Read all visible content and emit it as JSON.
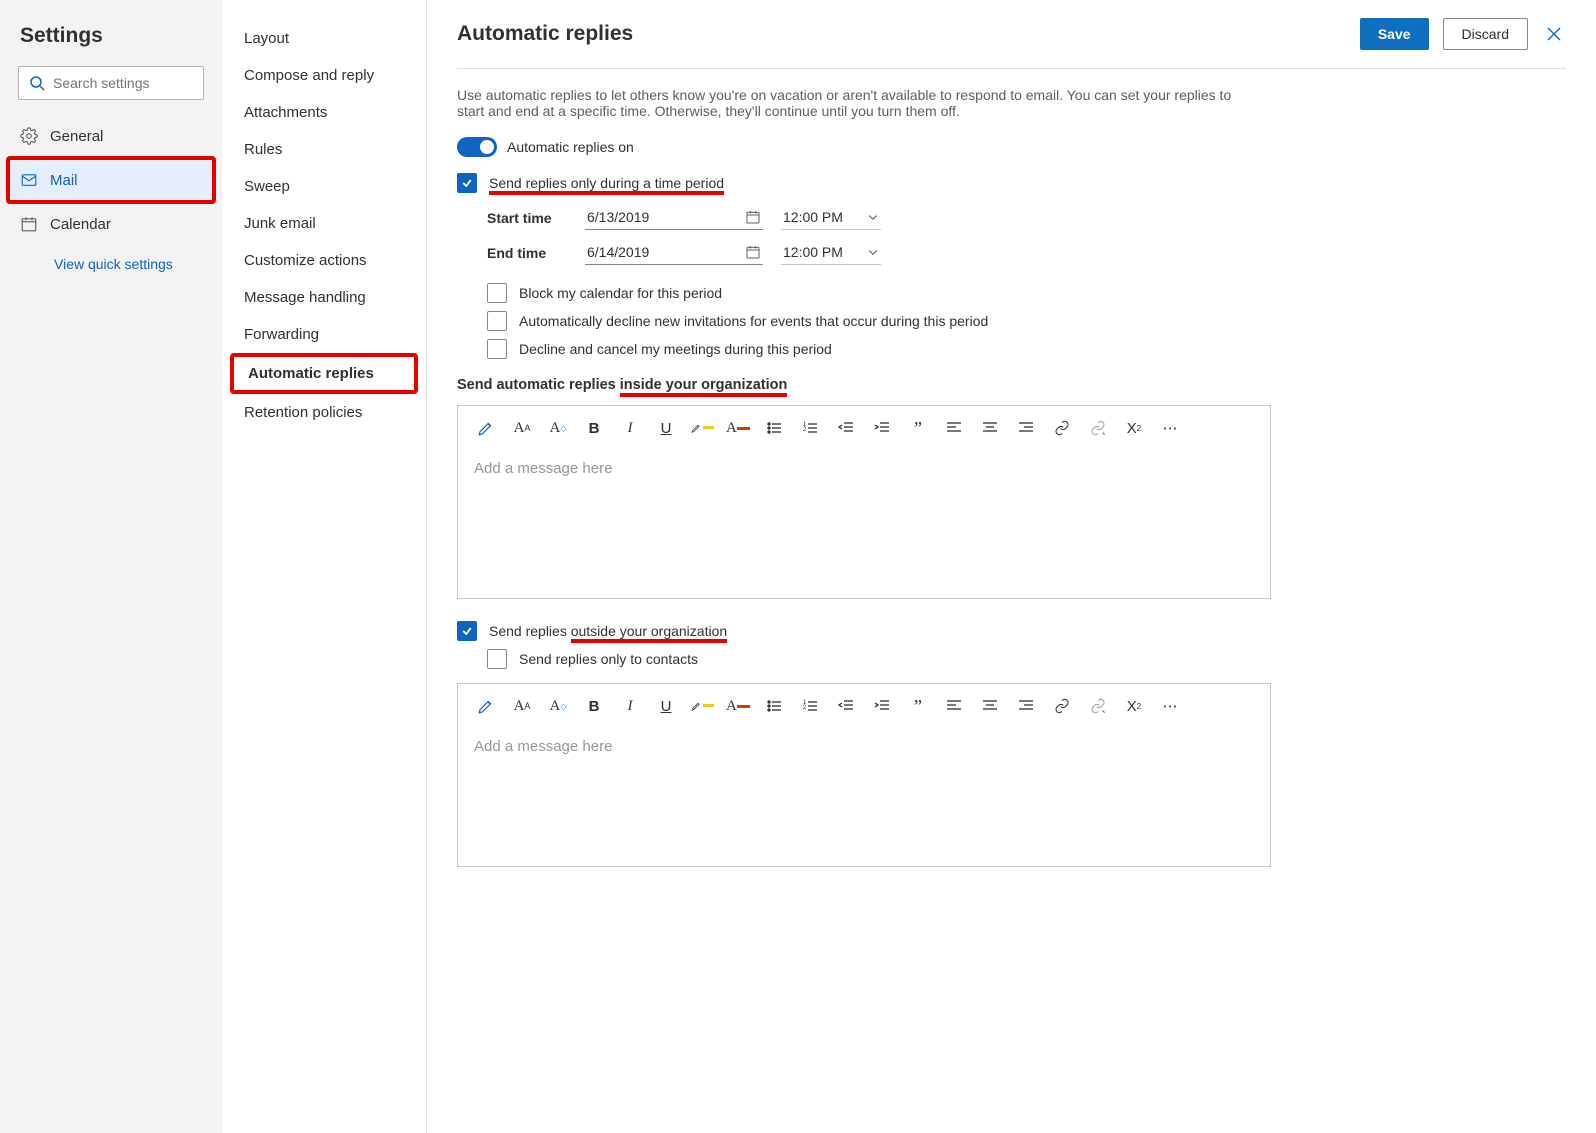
{
  "leftpane": {
    "title": "Settings",
    "searchPlaceholder": "Search settings",
    "categories": [
      {
        "label": "General"
      },
      {
        "label": "Mail",
        "active": true
      },
      {
        "label": "Calendar"
      }
    ],
    "quick": "View quick settings"
  },
  "subnav": [
    "Layout",
    "Compose and reply",
    "Attachments",
    "Rules",
    "Sweep",
    "Junk email",
    "Customize actions",
    "Message handling",
    "Forwarding",
    "Automatic replies",
    "Retention policies"
  ],
  "subnavActive": "Automatic replies",
  "page": {
    "title": "Automatic replies",
    "saveLabel": "Save",
    "discardLabel": "Discard",
    "description": "Use automatic replies to let others know you're on vacation or aren't available to respond to email. You can set your replies to start and end at a specific time. Otherwise, they'll continue until you turn them off.",
    "toggleLabel": "Automatic replies on",
    "timePeriodLabel": "Send replies only during a time period",
    "startLabel": "Start time",
    "startDate": "6/13/2019",
    "startTime": "12:00 PM",
    "endLabel": "End time",
    "endDate": "6/14/2019",
    "endTime": "12:00 PM",
    "opts": {
      "block": "Block my calendar for this period",
      "decline": "Automatically decline new invitations for events that occur during this period",
      "cancel": "Decline and cancel my meetings during this period"
    },
    "insideHeadingPre": "Send automatic replies ",
    "insideHeadingUnder": "inside your organization",
    "outsideCheckPre": "Send replies ",
    "outsideCheckUnder": "outside your organization",
    "contactsOnly": "Send replies only to contacts",
    "editorPlaceholder": "Add a message here"
  }
}
